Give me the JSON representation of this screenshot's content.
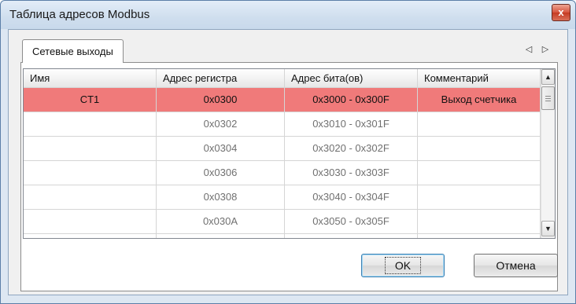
{
  "window": {
    "title": "Таблица адресов Modbus",
    "close_glyph": "x"
  },
  "tabs": [
    {
      "label": "Сетевые выходы",
      "selected": true
    }
  ],
  "tab_scroll": {
    "left_glyph": "◁",
    "right_glyph": "▷"
  },
  "grid": {
    "columns": [
      "Имя",
      "Адрес регистра",
      "Адрес бита(ов)",
      "Комментарий"
    ],
    "rows": [
      [
        "CT1",
        "0x0300",
        "0x3000 - 0x300F",
        "Выход счетчика"
      ],
      [
        "",
        "0x0302",
        "0x3010 - 0x301F",
        ""
      ],
      [
        "",
        "0x0304",
        "0x3020 - 0x302F",
        ""
      ],
      [
        "",
        "0x0306",
        "0x3030 - 0x303F",
        ""
      ],
      [
        "",
        "0x0308",
        "0x3040 - 0x304F",
        ""
      ],
      [
        "",
        "0x030A",
        "0x3050 - 0x305F",
        ""
      ],
      [
        "",
        "",
        "",
        ""
      ]
    ],
    "selected_row": 0,
    "selected_color": "#f07a7a"
  },
  "scrollbar": {
    "up_glyph": "▲",
    "down_glyph": "▼"
  },
  "buttons": {
    "ok_label": "OK",
    "cancel_label": "Отмена"
  }
}
